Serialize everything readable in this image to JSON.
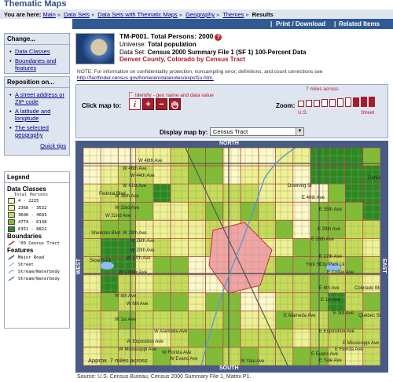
{
  "app": {
    "title": "Thematic Maps"
  },
  "breadcrumb": {
    "prefix": "You are here:",
    "items": [
      "Main",
      "Data Sets",
      "Data Sets with Thematic Maps",
      "Geography",
      "Themes"
    ],
    "current": "Results"
  },
  "topnav": {
    "print": "Print / Download",
    "related": "Related Items"
  },
  "change": {
    "title": "Change...",
    "items": [
      "Data Classes",
      "Boundaries and features"
    ]
  },
  "reposition": {
    "title": "Reposition on...",
    "items": [
      "A street address or ZIP code",
      "A latitude and longitude",
      "The selected geography"
    ],
    "quick_tips": "Quick tips"
  },
  "legend": {
    "title": "Legend",
    "data_classes_title": "Data Classes",
    "data_classes_sub": "Total Persons",
    "classes": [
      {
        "range": "4 - 2225",
        "color": "#fffac8"
      },
      {
        "range": "2368 - 3532",
        "color": "#eef290"
      },
      {
        "range": "3606 - 4693",
        "color": "#c5dd55"
      },
      {
        "range": "4774 - 6138",
        "color": "#7fbf2e"
      },
      {
        "range": "6351 - 8822",
        "color": "#2a8a1d"
      }
    ],
    "boundaries_title": "Boundaries",
    "boundaries": [
      "'00 Census Tract"
    ],
    "features_title": "Features",
    "features": [
      "Major Road",
      "Street",
      "Stream/Waterbody",
      "Stream/Waterbody"
    ]
  },
  "header": {
    "code": "TM-P001. Total Persons: 2000",
    "universe_label": "Universe:",
    "universe": "Total population",
    "dataset_label": "Data Set:",
    "dataset": "Census 2000 Summary File 1 (SF 1) 100-Percent Data",
    "geography": "Denver County, Colorado by Census Tract"
  },
  "note": {
    "text": "NOTE: For information on confidentiality protection, nonsampling error, definitions, and count corrections see",
    "url": "http://factfinder.census.gov/home/en/datanotes/expsf1u.htm."
  },
  "controls": {
    "click_map_to": "Click map to:",
    "identify": "Identify - geo name and data value",
    "zoom": "Zoom:",
    "seven_miles": "7 miles across",
    "us": "U.S.",
    "street": "Street",
    "zoom_levels": 10,
    "zoom_active_from": 7,
    "display_map_by": "Display map by:",
    "display_value": "Census Tract"
  },
  "map": {
    "north": "NORTH",
    "south": "SOUTH",
    "east": "EAST",
    "west": "WEST",
    "scale": "Approx. 7 miles across",
    "labels": [
      "W 48th Ave",
      "W 46th Ave",
      "W 44th Ave",
      "W 41st Ave",
      "W 38th Ave",
      "W 33rd Ave",
      "W 32nd Ave",
      "W 29th Ave",
      "W 26th Ave",
      "W 20th Ave",
      "W 17th Ave",
      "W Colfax Ave",
      "W 8th Ave",
      "W 6th Ave",
      "W 1st Ave",
      "W Alameda Ave",
      "W Exposition Ave",
      "W Mississippi Ave",
      "W Florida Ave",
      "W Evans Ave",
      "W Yale Ave",
      "E 40th Ave",
      "E 35th Ave",
      "E 29th Ave",
      "E 26th Ave",
      "E 17th Ave",
      "E Colfax Ave",
      "E 6th Ave",
      "E 1st Ave",
      "E Alameda Ave",
      "E 3rd Ave",
      "E Exposition Ave",
      "E Mississippi Ave",
      "E Florida Ave",
      "E Evans Ave",
      "E Yale Ave",
      "City Park Lk",
      "Sloan's Lk",
      "Federal Blvd",
      "Sheridan Blvd",
      "Downing St",
      "Colorado Blvd",
      "Quebec St",
      "York St",
      "Dahlia St"
    ]
  },
  "source": "Source: U.S. Census Bureau, Census 2000 Summary File 1, Matrix P1."
}
